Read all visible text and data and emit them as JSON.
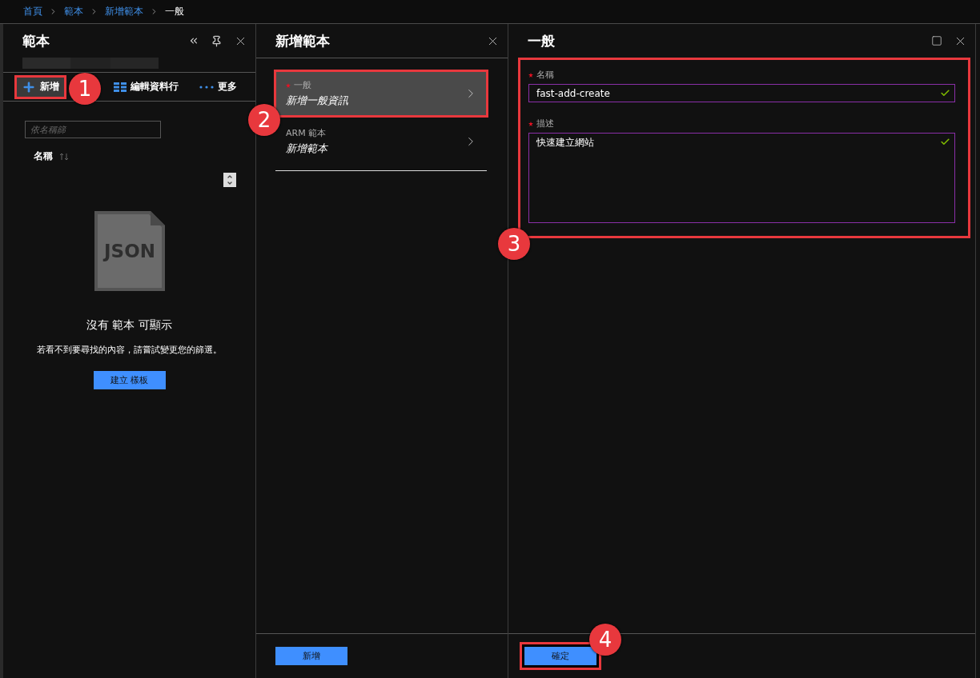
{
  "breadcrumb": [
    {
      "label": "首頁",
      "current": false
    },
    {
      "label": "範本",
      "current": false
    },
    {
      "label": "新增範本",
      "current": false
    },
    {
      "label": "一般",
      "current": true
    }
  ],
  "left": {
    "title": "範本",
    "toolbar": [
      {
        "kind": "add",
        "label": "新增",
        "highlighted": true,
        "callout": "1"
      },
      {
        "kind": "columns",
        "label": "編輯資料行",
        "highlighted": false
      },
      {
        "kind": "more",
        "label": "更多",
        "highlighted": false
      }
    ],
    "search": {
      "placeholder": "依名稱篩"
    },
    "column": "名稱",
    "empty": {
      "icon_label": "JSON",
      "title": "沒有 範本 可顯示",
      "message": "若看不到要尋找的內容，請嘗試變更您的篩選。",
      "button": "建立 樣板"
    }
  },
  "middle": {
    "title": "新增範本",
    "items": [
      {
        "title": "一般",
        "subtitle": "新增一般資訊",
        "required": true,
        "selected": true,
        "callout": "2"
      },
      {
        "title": "ARM 範本",
        "subtitle": "新增範本",
        "required": false,
        "selected": false
      }
    ],
    "button": "新增"
  },
  "right": {
    "title": "一般",
    "form": {
      "highlighted": true,
      "callout": "3",
      "fields": [
        {
          "kind": "input",
          "label": "名稱",
          "required": true,
          "valid": true,
          "value": "fast-add-create"
        },
        {
          "kind": "textarea",
          "label": "描述",
          "required": true,
          "valid": true,
          "value": "快速建立網站"
        }
      ]
    },
    "button": {
      "label": "確定",
      "highlighted": true,
      "callout": "4"
    }
  }
}
